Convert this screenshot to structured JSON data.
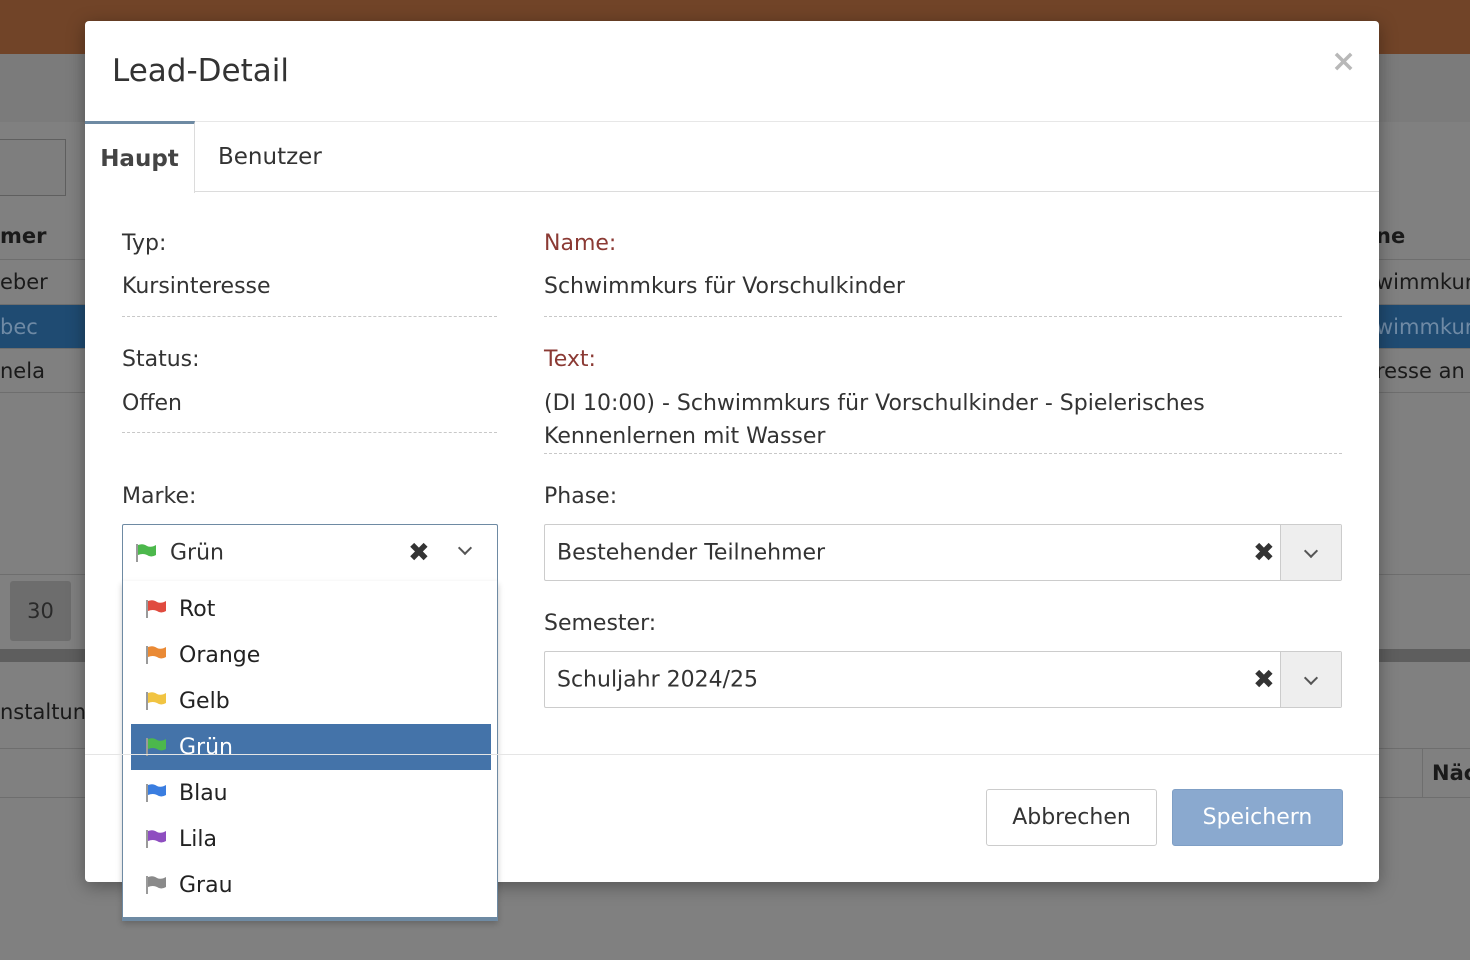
{
  "background": {
    "table_header_left": "mer",
    "table_header_right": "ne",
    "rows": [
      {
        "left": "eber",
        "right": "wimmkur"
      },
      {
        "left": "bec",
        "right": "wimmkur"
      },
      {
        "left": "nela",
        "right": "resse an"
      }
    ],
    "page_number": "30",
    "section_title": "nstaltun",
    "table2_header": "Näc"
  },
  "modal": {
    "title": "Lead-Detail",
    "close_glyph": "×",
    "tabs": [
      {
        "label": "Haupt",
        "active": true
      },
      {
        "label": "Benutzer",
        "active": false
      }
    ],
    "fields": {
      "typ_label": "Typ:",
      "typ_value": "Kursinteresse",
      "status_label": "Status:",
      "status_value": "Offen",
      "marke_label": "Marke:",
      "marke_value": "Grün",
      "name_label": "Name:",
      "name_value": "Schwimmkurs für Vorschulkinder",
      "text_label": "Text:",
      "text_value_line1": "(DI 10:00) - Schwimmkurs für Vorschulkinder - Spielerisches",
      "text_value_line2": "Kennenlernen mit Wasser",
      "phase_label": "Phase:",
      "phase_value": "Bestehender Teilnehmer",
      "semester_label": "Semester:",
      "semester_value": "Schuljahr 2024/25"
    },
    "clear_glyph": "✖",
    "marke_options": [
      {
        "label": "Rot",
        "color": "#e04b3f",
        "selected": false
      },
      {
        "label": "Orange",
        "color": "#ea8a35",
        "selected": false
      },
      {
        "label": "Gelb",
        "color": "#f1c442",
        "selected": false
      },
      {
        "label": "Grün",
        "color": "#4cb84c",
        "selected": true
      },
      {
        "label": "Blau",
        "color": "#3a7de0",
        "selected": false
      },
      {
        "label": "Lila",
        "color": "#8e4ec0",
        "selected": false
      },
      {
        "label": "Grau",
        "color": "#8a8a8a",
        "selected": false
      }
    ],
    "buttons": {
      "cancel": "Abbrechen",
      "save": "Speichern"
    }
  },
  "colors": {
    "topbar": "#714428",
    "accent": "#6e8aa3",
    "selected_option": "#4473a9",
    "label_red": "#8b3a34",
    "save_button": "#8aa9cf"
  }
}
